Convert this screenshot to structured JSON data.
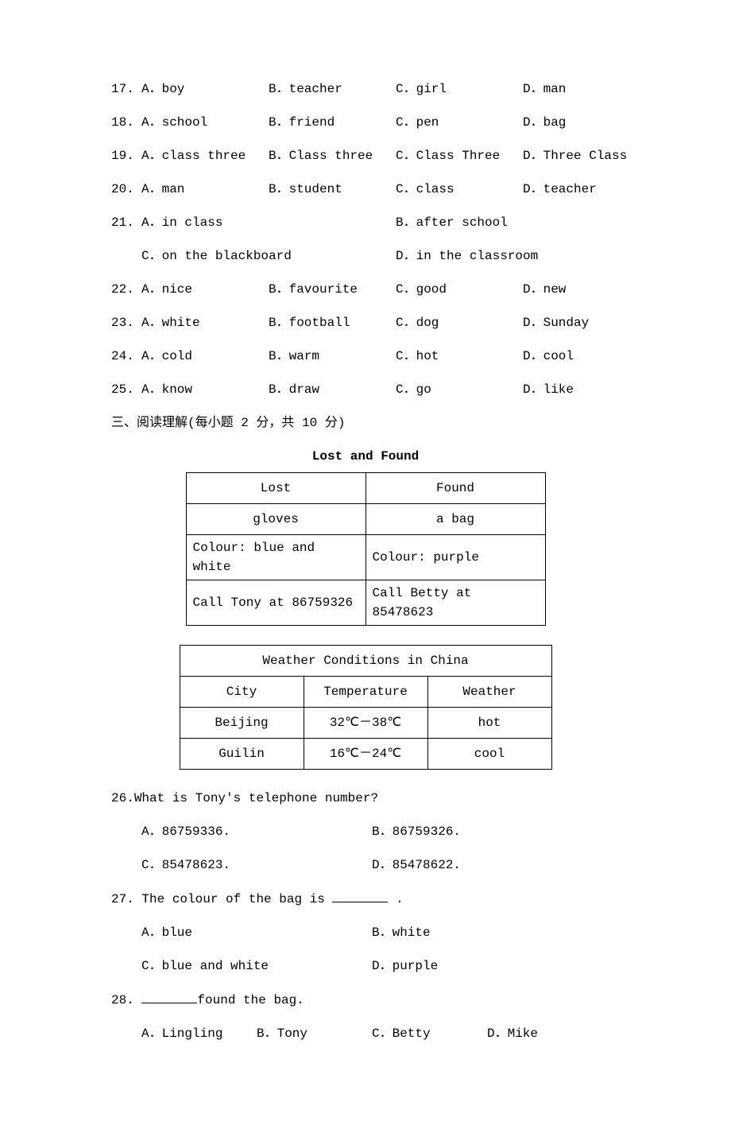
{
  "questions_cloze": [
    {
      "num": "17.",
      "A": "A．boy",
      "B": "B．teacher",
      "C": "C．girl",
      "D": "D．man"
    },
    {
      "num": "18.",
      "A": "A．school",
      "B": "B．friend",
      "C": "C．pen",
      "D": "D．bag"
    },
    {
      "num": "19.",
      "A": "A．class three",
      "B": "B．Class three",
      "C": "C．Class Three",
      "D": "D．Three Class"
    },
    {
      "num": "20.",
      "A": "A．man",
      "B": "B．student",
      "C": "C．class",
      "D": "D．teacher"
    },
    {
      "num": "21.",
      "A": "A．in class",
      "B": "B．after school",
      "C": "C．on the blackboard",
      "D": "D．in the classroom",
      "layout": "2x2"
    },
    {
      "num": "22.",
      "A": "A．nice",
      "B": "B．favourite",
      "C": "C．good",
      "D": "D．new"
    },
    {
      "num": "23.",
      "A": "A．white",
      "B": "B．football",
      "C": "C．dog",
      "D": "D．Sunday"
    },
    {
      "num": "24.",
      "A": "A．cold",
      "B": "B．warm",
      "C": "C．hot",
      "D": "D．cool"
    },
    {
      "num": "25.",
      "A": "A．know",
      "B": "B．draw",
      "C": "C．go",
      "D": "D．like"
    }
  ],
  "section3_header": "三、阅读理解(每小题 2 分，共 10 分)",
  "reading": {
    "lf_title": "Lost and Found",
    "lf": {
      "lost_h": "Lost",
      "found_h": "Found",
      "lost_item": "gloves",
      "found_item": "a bag",
      "lost_color": "Colour: blue and white",
      "found_color": "Colour: purple",
      "lost_call": "Call Tony at 86759326",
      "found_call": "Call Betty at 85478623"
    },
    "wc_title": "Weather Conditions in China",
    "wc": {
      "h1": "City",
      "h2": "Temperature",
      "h3": "Weather",
      "r1c1": "Beijing",
      "r1c2": "32℃－38℃",
      "r1c3": "hot",
      "r2c1": "Guilin",
      "r2c2": "16℃－24℃",
      "r2c3": "cool"
    }
  },
  "q26": {
    "stem_pre": "26.",
    "stem": "What is Tony's telephone number?",
    "A": "A．86759336.",
    "B": "B．86759326.",
    "C": "C．85478623.",
    "D": "D．85478622."
  },
  "q27": {
    "stem_num": "27.",
    "stem_pre": "The colour of the bag is ",
    "stem_post": " .",
    "A": "A．blue",
    "B": "B．white",
    "C": "C．blue and white",
    "D": "D．purple"
  },
  "q28": {
    "stem_num": "28.",
    "stem_post": "found the bag.",
    "A": "A．Lingling",
    "B": "B．Tony",
    "C": "C．Betty",
    "D": "D．Mike"
  }
}
